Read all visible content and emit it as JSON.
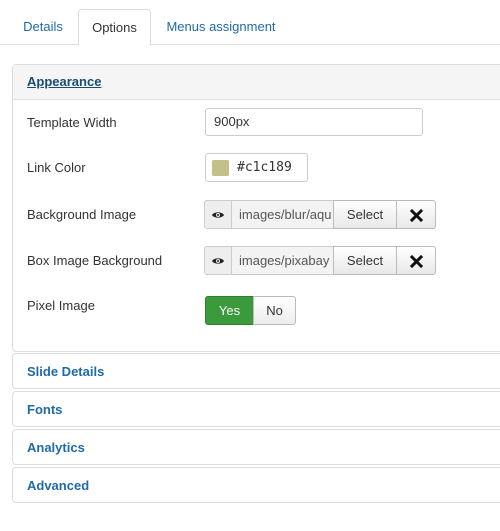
{
  "tabs": [
    {
      "label": "Details",
      "active": false
    },
    {
      "label": "Options",
      "active": true
    },
    {
      "label": "Menus assignment",
      "active": false
    }
  ],
  "appearance": {
    "title": "Appearance",
    "template_width": {
      "label": "Template Width",
      "value": "900px"
    },
    "link_color": {
      "label": "Link Color",
      "value": "#c1c189",
      "swatch": "#c1c189"
    },
    "background_image": {
      "label": "Background Image",
      "path": "images/blur/aqu",
      "select_label": "Select",
      "preview_icon": "eye-icon",
      "clear_icon": "close-icon"
    },
    "box_image_background": {
      "label": "Box Image Background",
      "path": "images/pixabay",
      "select_label": "Select",
      "preview_icon": "eye-icon",
      "clear_icon": "close-icon"
    },
    "pixel_image": {
      "label": "Pixel Image",
      "yes_label": "Yes",
      "no_label": "No",
      "selected": "Yes"
    }
  },
  "sections": [
    {
      "title": "Slide Details"
    },
    {
      "title": "Fonts"
    },
    {
      "title": "Analytics"
    },
    {
      "title": "Advanced"
    }
  ],
  "colors": {
    "link": "#1f6aaa",
    "active_green": "#3b9a3b",
    "border": "#dddddd"
  }
}
